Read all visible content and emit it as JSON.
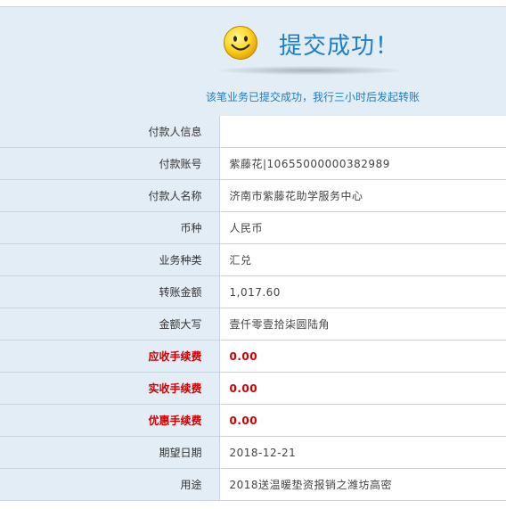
{
  "result": {
    "title": "提交成功！",
    "message": "该笔业务已提交成功，我行三小时后发起转账",
    "icon": "smiley-icon"
  },
  "colors": {
    "accent": "#1e7dc8",
    "label_bg": "#e3edf6",
    "border": "#c7d6e6",
    "fee_red": "#cc0000"
  },
  "details": [
    {
      "label": "付款人信息",
      "value": "",
      "highlight": false
    },
    {
      "label": "付款账号",
      "value": "紫藤花|10655000000382989",
      "highlight": false
    },
    {
      "label": "付款人名称",
      "value": "济南市紫藤花助学服务中心",
      "highlight": false
    },
    {
      "label": "币种",
      "value": "人民币",
      "highlight": false
    },
    {
      "label": "业务种类",
      "value": "汇兑",
      "highlight": false
    },
    {
      "label": "转账金额",
      "value": "1,017.60",
      "highlight": false
    },
    {
      "label": "金额大写",
      "value": "壹仟零壹拾柒圆陆角",
      "highlight": false
    },
    {
      "label": "应收手续费",
      "value": "0.00",
      "highlight": true
    },
    {
      "label": "实收手续费",
      "value": "0.00",
      "highlight": true
    },
    {
      "label": "优惠手续费",
      "value": "0.00",
      "highlight": true
    },
    {
      "label": "期望日期",
      "value": "2018-12-21",
      "highlight": false
    },
    {
      "label": "用途",
      "value": "2018送温暖垫资报销之潍坊高密",
      "highlight": false
    }
  ]
}
